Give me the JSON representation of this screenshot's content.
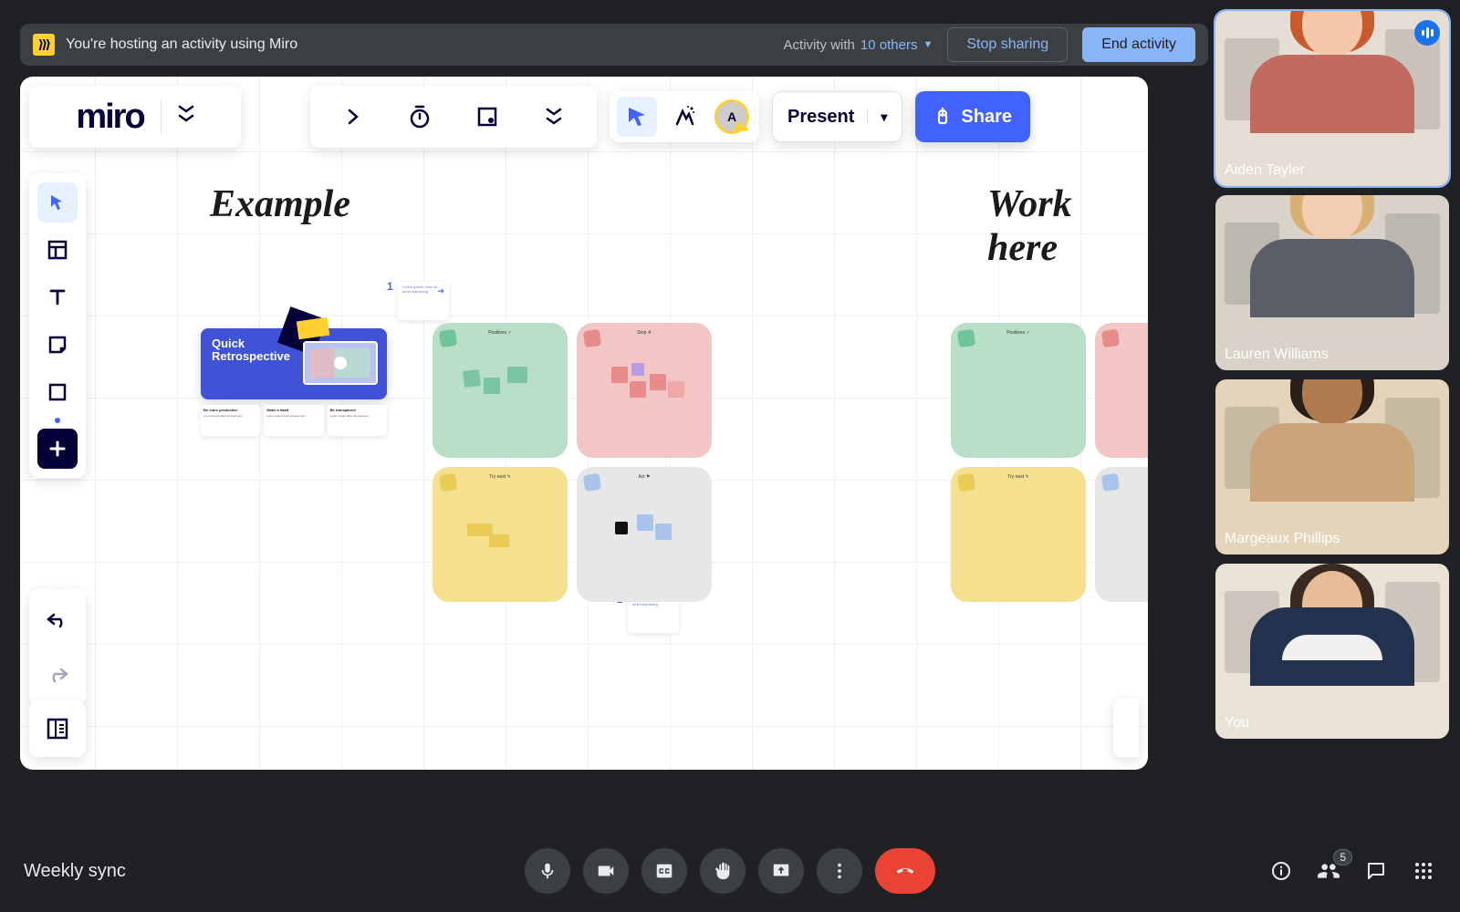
{
  "banner": {
    "host_text": "You're hosting an activity using Miro",
    "activity_with_prefix": "Activity with ",
    "activity_with_count": "10 others",
    "stop_sharing": "Stop sharing",
    "end_activity": "End activity"
  },
  "miro": {
    "logo": "miro",
    "present": "Present",
    "share": "Share",
    "avatar_initial": "A",
    "labels": {
      "example": "Example",
      "work_here": "Work here"
    },
    "retro": {
      "title_line1": "Quick",
      "title_line2": "Retrospective"
    },
    "retro_subcards": [
      {
        "heading": "Be more productive"
      },
      {
        "heading": "Make a habit"
      },
      {
        "heading": "Be transparent"
      }
    ],
    "step_labels": {
      "step1": "1",
      "step2": "2"
    }
  },
  "participants": [
    {
      "name": "Aiden Tayler",
      "active": true,
      "speaking": true,
      "room_bg": "#e6ddd4",
      "skin": "#f3c7a7",
      "hair": "#c85a2e",
      "shirt": "#c06a61"
    },
    {
      "name": "Lauren Williams",
      "active": false,
      "speaking": false,
      "room_bg": "#d8d2c8",
      "skin": "#f2cdb0",
      "hair": "#d9b074",
      "shirt": "#5b5e66"
    },
    {
      "name": "Margeaux Phillips",
      "active": false,
      "speaking": false,
      "room_bg": "#e3d4ba",
      "skin": "#b07a4f",
      "hair": "#2b1f1a",
      "shirt": "#caa57a"
    },
    {
      "name": "You",
      "active": false,
      "speaking": false,
      "room_bg": "#e9e2d6",
      "skin": "#e7bd97",
      "hair": "#3a2b22",
      "shirt": "#23324f",
      "collar": "#f1efef"
    }
  ],
  "meet": {
    "title": "Weekly sync",
    "people_count": "5"
  }
}
